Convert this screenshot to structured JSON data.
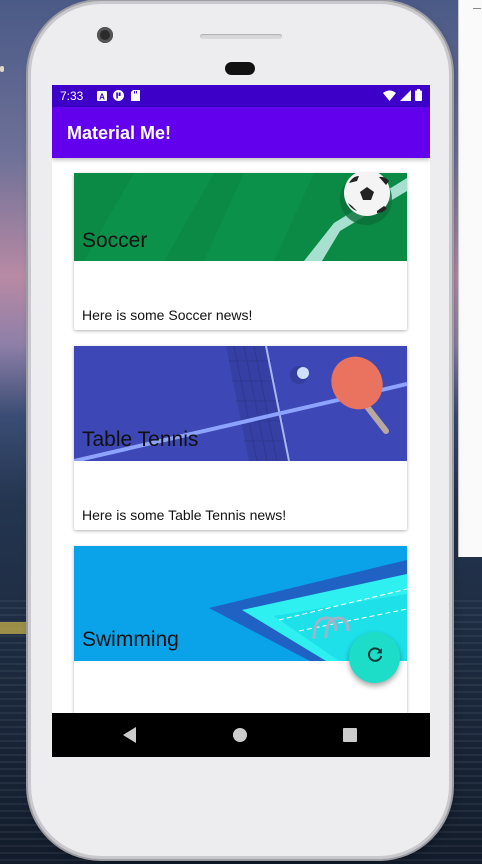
{
  "status_bar": {
    "time": "7:33",
    "icons": [
      "notification-a-icon",
      "notification-p-icon",
      "sd-card-icon"
    ],
    "right_icons": [
      "wifi-icon",
      "signal-icon",
      "battery-icon"
    ]
  },
  "app_bar": {
    "title": "Material Me!"
  },
  "cards": [
    {
      "title": "Soccer",
      "news": "Here is some Soccer news!"
    },
    {
      "title": "Table Tennis",
      "news": "Here is some Table Tennis news!"
    },
    {
      "title": "Swimming",
      "news": ""
    }
  ],
  "fab": {
    "icon": "refresh-icon"
  },
  "nav_bar": {
    "buttons": [
      "back-icon",
      "home-icon",
      "recents-icon"
    ]
  },
  "colors": {
    "status_bar": "#3d00c8",
    "app_bar": "#6200ee",
    "fab": "#1ddcc8",
    "soccer": "#0b8a45",
    "table_tennis": "#3d47b5",
    "swimming": "#0aa3ea"
  }
}
